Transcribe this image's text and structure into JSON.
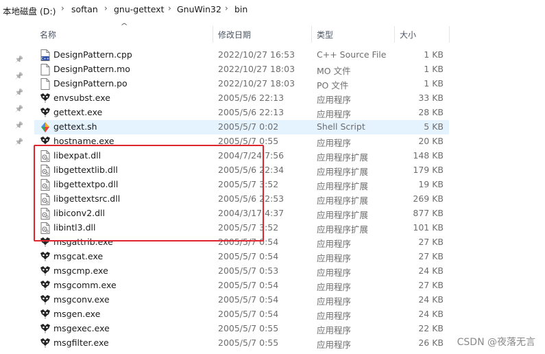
{
  "breadcrumb": [
    "本地磁盘 (D:)",
    "softan",
    "gnu-gettext",
    "GnuWin32",
    "bin"
  ],
  "columns": {
    "name": "名称",
    "date": "修改日期",
    "type": "类型",
    "size": "大小"
  },
  "files": [
    {
      "name": "DesignPattern.cpp",
      "date": "2022/10/27 16:53",
      "type": "C++ Source File",
      "size": "1 KB",
      "icon": "cpp-file-icon"
    },
    {
      "name": "DesignPattern.mo",
      "date": "2022/10/27 18:03",
      "type": "MO 文件",
      "size": "1 KB",
      "icon": "blank-file-icon"
    },
    {
      "name": "DesignPattern.po",
      "date": "2022/10/27 18:03",
      "type": "PO 文件",
      "size": "1 KB",
      "icon": "blank-file-icon"
    },
    {
      "name": "envsubst.exe",
      "date": "2005/5/6 22:13",
      "type": "应用程序",
      "size": "33 KB",
      "icon": "gnu-exe-icon"
    },
    {
      "name": "gettext.exe",
      "date": "2005/5/6 22:13",
      "type": "应用程序",
      "size": "28 KB",
      "icon": "gnu-exe-icon"
    },
    {
      "name": "gettext.sh",
      "date": "2005/5/7 0:02",
      "type": "Shell Script",
      "size": "5 KB",
      "icon": "shell-script-icon",
      "selected": true
    },
    {
      "name": "hostname.exe",
      "date": "2005/5/7 0:55",
      "type": "应用程序",
      "size": "20 KB",
      "icon": "gnu-exe-icon"
    },
    {
      "name": "libexpat.dll",
      "date": "2004/7/24 7:56",
      "type": "应用程序扩展",
      "size": "148 KB",
      "icon": "dll-file-icon"
    },
    {
      "name": "libgettextlib.dll",
      "date": "2005/5/6 22:34",
      "type": "应用程序扩展",
      "size": "179 KB",
      "icon": "dll-file-icon"
    },
    {
      "name": "libgettextpo.dll",
      "date": "2005/5/7 3:52",
      "type": "应用程序扩展",
      "size": "19 KB",
      "icon": "dll-file-icon"
    },
    {
      "name": "libgettextsrc.dll",
      "date": "2005/5/6 22:53",
      "type": "应用程序扩展",
      "size": "269 KB",
      "icon": "dll-file-icon"
    },
    {
      "name": "libiconv2.dll",
      "date": "2004/3/17 4:37",
      "type": "应用程序扩展",
      "size": "877 KB",
      "icon": "dll-file-icon"
    },
    {
      "name": "libintl3.dll",
      "date": "2005/5/7 3:52",
      "type": "应用程序扩展",
      "size": "101 KB",
      "icon": "dll-file-icon"
    },
    {
      "name": "msgattrib.exe",
      "date": "2005/5/7 0:54",
      "type": "应用程序",
      "size": "27 KB",
      "icon": "gnu-exe-icon"
    },
    {
      "name": "msgcat.exe",
      "date": "2005/5/7 0:54",
      "type": "应用程序",
      "size": "27 KB",
      "icon": "gnu-exe-icon"
    },
    {
      "name": "msgcmp.exe",
      "date": "2005/5/7 0:53",
      "type": "应用程序",
      "size": "24 KB",
      "icon": "gnu-exe-icon"
    },
    {
      "name": "msgcomm.exe",
      "date": "2005/5/7 0:54",
      "type": "应用程序",
      "size": "27 KB",
      "icon": "gnu-exe-icon"
    },
    {
      "name": "msgconv.exe",
      "date": "2005/5/7 0:54",
      "type": "应用程序",
      "size": "24 KB",
      "icon": "gnu-exe-icon"
    },
    {
      "name": "msgen.exe",
      "date": "2005/5/7 0:54",
      "type": "应用程序",
      "size": "24 KB",
      "icon": "gnu-exe-icon"
    },
    {
      "name": "msgexec.exe",
      "date": "2005/5/7 0:55",
      "type": "应用程序",
      "size": "22 KB",
      "icon": "gnu-exe-icon"
    },
    {
      "name": "msgfilter.exe",
      "date": "2005/5/7 0:55",
      "type": "应用程序",
      "size": "26 KB",
      "icon": "gnu-exe-icon"
    }
  ],
  "quick_access_pins": 6,
  "annotation": {
    "color": "#e0242b"
  },
  "colors": {
    "selected_row": "#e5f3ff"
  },
  "watermark": "CSDN @夜落无言"
}
